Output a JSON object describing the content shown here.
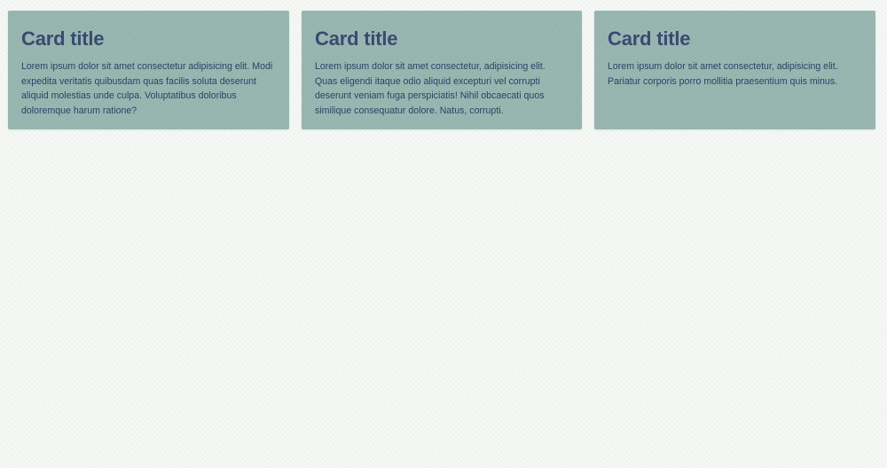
{
  "colors": {
    "page_background": "#f5f8f4",
    "card_background": "#97b6b0",
    "title_color": "#3a4a72",
    "text_color": "#2f3f64"
  },
  "cards": [
    {
      "title": "Card title",
      "body": "Lorem ipsum dolor sit amet consectetur adipisicing elit. Modi expedita veritatis quibusdam quas facilis soluta deserunt aliquid molestias unde culpa. Voluptatibus doloribus doloremque harum ratione?"
    },
    {
      "title": "Card title",
      "body": "Lorem ipsum dolor sit amet consectetur, adipisicing elit. Quas eligendi itaque odio aliquid excepturi vel corrupti deserunt veniam fuga perspiciatis! Nihil obcaecati quos similique consequatur dolore. Natus, corrupti."
    },
    {
      "title": "Card title",
      "body": "Lorem ipsum dolor sit amet consectetur, adipisicing elit. Pariatur corporis porro mollitia praesentium quis minus."
    }
  ]
}
